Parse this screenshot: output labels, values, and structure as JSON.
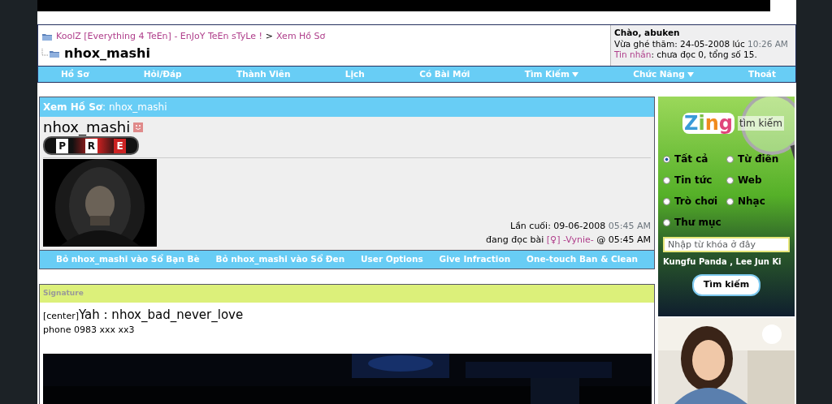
{
  "breadcrumb": {
    "forum_link": "KoolZ [Everything 4 TeEn] - EnJoY TeEn sTyLe !",
    "separator": ">",
    "current_link": "Xem Hồ Sơ",
    "page_title": "nhox_mashi"
  },
  "welcome": {
    "greeting": "Chào, abuken",
    "last_visit_label": "Vừa ghé thăm: 24-05-2008 lúc",
    "last_visit_time": "10:26 AM",
    "messages_link": "Tin nhắn",
    "messages_text": ": chưa đọc 0, tổng số 15."
  },
  "nav": [
    {
      "label": "Hồ Sơ",
      "dropdown": false
    },
    {
      "label": "Hỏi/Đáp",
      "dropdown": false
    },
    {
      "label": "Thành Viên",
      "dropdown": false
    },
    {
      "label": "Lịch",
      "dropdown": false
    },
    {
      "label": "Có Bài Mới",
      "dropdown": false
    },
    {
      "label": "Tìm Kiếm",
      "dropdown": true
    },
    {
      "label": "Chức Năng",
      "dropdown": true
    },
    {
      "label": "Thoát",
      "dropdown": false
    }
  ],
  "profile": {
    "header_label": "Xem Hồ Sơ",
    "header_user": ": nhox_mashi",
    "username": "nhox_mashi",
    "rank_letters": [
      "P",
      "R",
      "E"
    ],
    "last_active_label": "Lần cuối: 09-06-2008",
    "last_active_time": "05:45 AM",
    "reading_label": "đang đọc bài",
    "reading_gender": "[♀]",
    "reading_user": "-Vynie-",
    "reading_time": "@ 05:45 AM"
  },
  "profile_actions": [
    "Bỏ nhox_mashi vào Sổ Bạn Bè",
    "Bỏ nhox_mashi vào Sổ Đen",
    "User Options",
    "Give Infraction",
    "One-touch Ban & Clean"
  ],
  "signature": {
    "header": "Signature",
    "tag": "[center]",
    "line1": "Yah : nhox_bad_never_love",
    "line2": "phone 0983 xxx xx3"
  },
  "search_widget": {
    "brand": "Zing",
    "brand_sub": "tìm kiếm",
    "options": [
      {
        "label": "Tất cả",
        "selected": true
      },
      {
        "label": "Từ điển",
        "selected": false
      },
      {
        "label": "Tin tức",
        "selected": false
      },
      {
        "label": "Web",
        "selected": false
      },
      {
        "label": "Trò chơi",
        "selected": false
      },
      {
        "label": "Nhạc",
        "selected": false
      },
      {
        "label": "Thư mục",
        "selected": false
      }
    ],
    "placeholder": "Nhập từ khóa ở đây",
    "hot_keywords": "Kungfu Panda , Lee Jun Ki",
    "button": "Tìm kiếm"
  }
}
